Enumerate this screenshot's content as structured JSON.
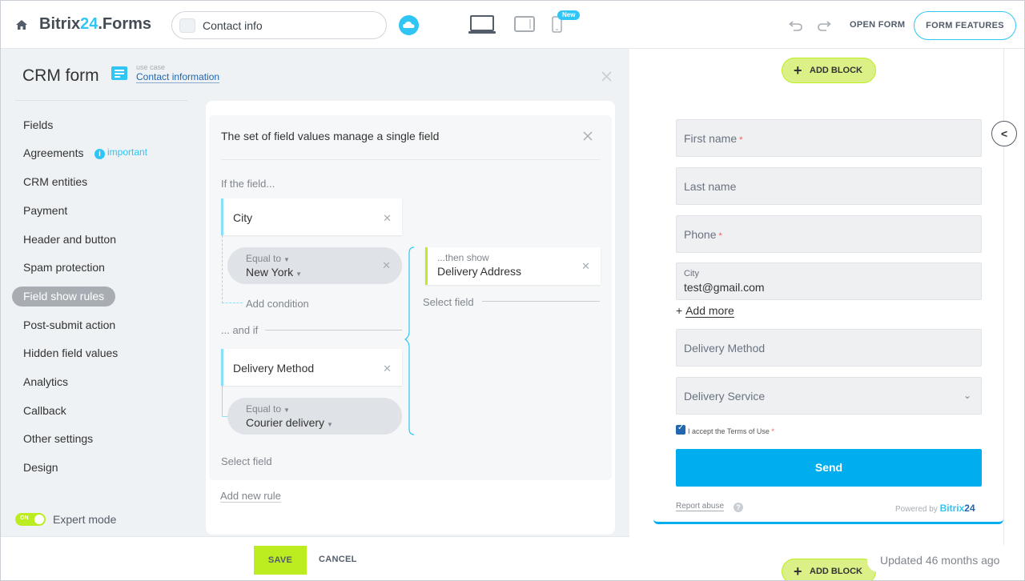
{
  "header": {
    "brand_prefix": "Bitrix",
    "brand_number": "24",
    "brand_suffix": ".Forms",
    "form_name": "Contact info",
    "new_badge": "New",
    "open_form": "OPEN FORM",
    "form_features": "FORM FEATURES"
  },
  "sidebar": {
    "title": "CRM form",
    "use_case_label": "use case",
    "use_case_value": "Contact information",
    "important": "important",
    "items": [
      {
        "label": "Fields"
      },
      {
        "label": "Agreements"
      },
      {
        "label": "CRM entities"
      },
      {
        "label": "Payment"
      },
      {
        "label": "Header and button"
      },
      {
        "label": "Spam protection"
      },
      {
        "label": "Field show rules"
      },
      {
        "label": "Post-submit action"
      },
      {
        "label": "Hidden field values"
      },
      {
        "label": "Analytics"
      },
      {
        "label": "Callback"
      },
      {
        "label": "Other settings"
      },
      {
        "label": "Design"
      }
    ],
    "active_item": "Field show rules",
    "expert_toggle": "ON",
    "expert_mode": "Expert mode"
  },
  "rule": {
    "title": "The set of field values manage a single field",
    "if_label": "If the field...",
    "field_1": "City",
    "cond_1_operator": "Equal to",
    "cond_1_value": "New York",
    "add_condition": "Add condition",
    "and_if": "... and if",
    "field_2": "Delivery Method",
    "cond_2_operator": "Equal to",
    "cond_2_value": "Courier delivery",
    "select_field_left": "Select field",
    "then_show": "...then show",
    "then_field": "Delivery Address",
    "select_field_right": "Select field",
    "add_new_rule": "Add new rule"
  },
  "footer": {
    "save": "SAVE",
    "cancel": "CANCEL"
  },
  "preview": {
    "add_block": "ADD BLOCK",
    "first_name": "First name",
    "last_name": "Last name",
    "phone": "Phone",
    "city_label": "City",
    "city_value": "test@gmail.com",
    "add_more": "Add more",
    "delivery_method": "Delivery Method",
    "delivery_service": "Delivery Service",
    "terms": "I accept the Terms of Use",
    "required_mark": "*",
    "send": "Send",
    "report_abuse": "Report abuse",
    "powered_by": "Powered by",
    "powered_brand": "Bitrix",
    "powered_number": "24",
    "updated": "Updated 46 months ago"
  },
  "colors": {
    "accent": "#2fc6f6",
    "lime": "#bbed21",
    "send": "#00aeef",
    "link": "#2067b0"
  }
}
